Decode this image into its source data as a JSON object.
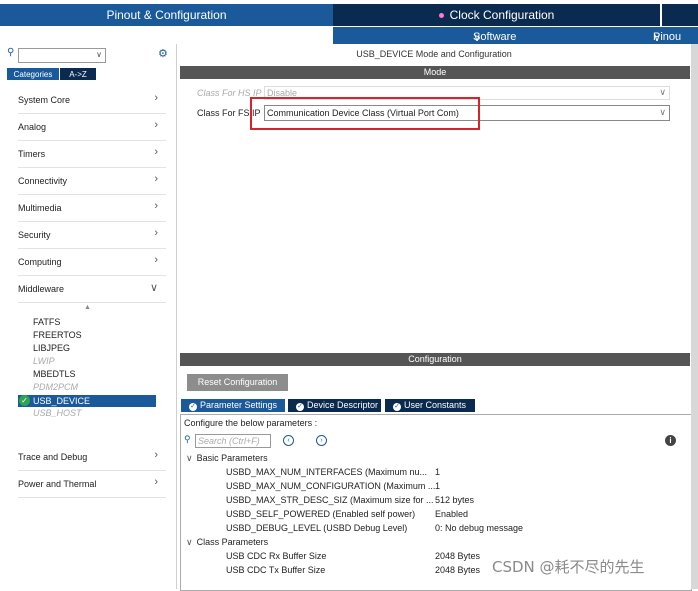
{
  "header": {
    "tab_pinout": "Pinout & Configuration",
    "tab_clock": "Clock Configuration",
    "software_packs": "Software Packs",
    "pinout_menu": "Pinou"
  },
  "sidebar": {
    "search_placeholder": "",
    "seg_categories": "Categories",
    "seg_az": "A->Z",
    "categories": [
      {
        "label": "System Core"
      },
      {
        "label": "Analog"
      },
      {
        "label": "Timers"
      },
      {
        "label": "Connectivity"
      },
      {
        "label": "Multimedia"
      },
      {
        "label": "Security"
      },
      {
        "label": "Computing"
      },
      {
        "label": "Middleware"
      }
    ],
    "middleware_items": [
      {
        "label": "FATFS",
        "enabled": true
      },
      {
        "label": "FREERTOS",
        "enabled": true
      },
      {
        "label": "LIBJPEG",
        "enabled": true
      },
      {
        "label": "LWIP",
        "enabled": false
      },
      {
        "label": "MBEDTLS",
        "enabled": true
      },
      {
        "label": "PDM2PCM",
        "enabled": false
      },
      {
        "label": "USB_DEVICE",
        "enabled": true,
        "selected": true
      },
      {
        "label": "USB_HOST",
        "enabled": false
      }
    ],
    "bottom_categories": [
      {
        "label": "Trace and Debug"
      },
      {
        "label": "Power and Thermal"
      }
    ]
  },
  "mode": {
    "title": "USB_DEVICE Mode and Configuration",
    "bar": "Mode",
    "hs_label": "Class For HS IP",
    "hs_value": "Disable",
    "fs_label": "Class For FS IP",
    "fs_value": "Communication Device Class (Virtual Port Com)"
  },
  "config": {
    "bar": "Configuration",
    "reset_button": "Reset Configuration",
    "tabs": [
      "Parameter Settings",
      "Device Descriptor",
      "User Constants"
    ],
    "hint": "Configure the below parameters :",
    "search_placeholder": "Search (Ctrl+F)",
    "info_glyph": "i",
    "groups": [
      {
        "name": "Basic Parameters",
        "params": [
          {
            "name": "USBD_MAX_NUM_INTERFACES (Maximum nu...",
            "value": "1"
          },
          {
            "name": "USBD_MAX_NUM_CONFIGURATION (Maximum ...",
            "value": "1"
          },
          {
            "name": "USBD_MAX_STR_DESC_SIZ (Maximum size for ...",
            "value": "512 bytes"
          },
          {
            "name": "USBD_SELF_POWERED (Enabled self power)",
            "value": "Enabled"
          },
          {
            "name": "USBD_DEBUG_LEVEL (USBD Debug Level)",
            "value": "0: No debug message"
          }
        ]
      },
      {
        "name": "Class Parameters",
        "params": [
          {
            "name": "USB CDC Rx Buffer Size",
            "value": "2048 Bytes"
          },
          {
            "name": "USB CDC Tx Buffer Size",
            "value": "2048 Bytes"
          }
        ]
      }
    ]
  },
  "watermark": "CSDN @耗不尽的先生",
  "colors": {
    "accent": "#1a5a9a",
    "dark": "#0b2a4f",
    "highlight": "#d9232a"
  }
}
